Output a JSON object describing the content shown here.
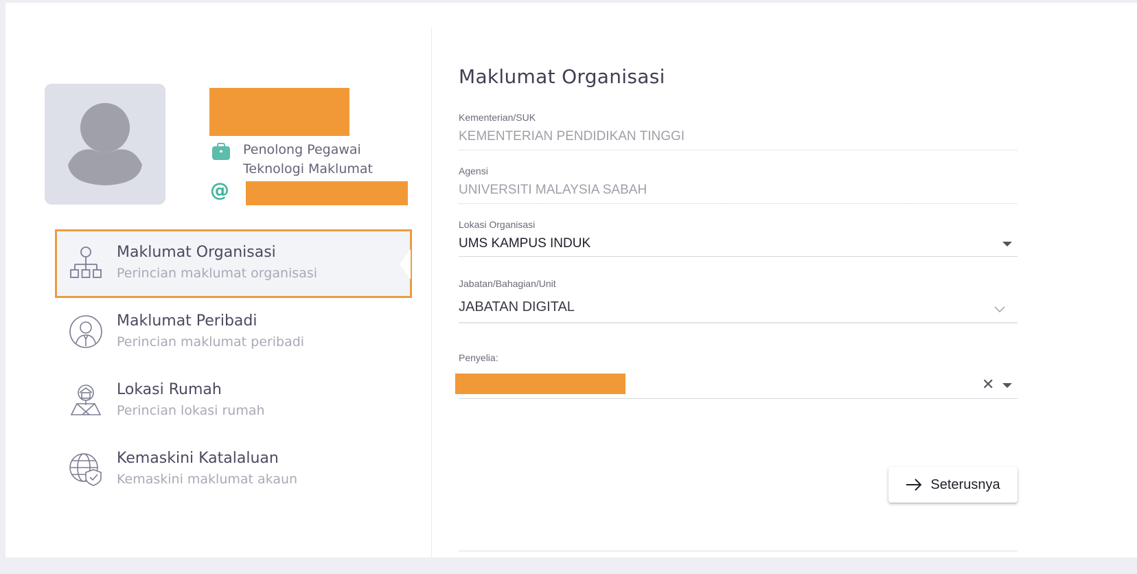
{
  "profile": {
    "job_title": "Penolong Pegawai Teknologi Maklumat",
    "icons": {
      "job": "briefcase-icon",
      "email": "at-icon"
    },
    "redaction_color": "#f29937"
  },
  "menu": {
    "items": [
      {
        "title": "Maklumat Organisasi",
        "subtitle": "Perincian maklumat organisasi",
        "icon": "org-chart-icon",
        "active": true
      },
      {
        "title": "Maklumat Peribadi",
        "subtitle": "Perincian maklumat peribadi",
        "icon": "person-icon",
        "active": false
      },
      {
        "title": "Lokasi Rumah",
        "subtitle": "Perincian lokasi rumah",
        "icon": "house-icon",
        "active": false
      },
      {
        "title": "Kemaskini Katalaluan",
        "subtitle": "Kemaskini maklumat akaun",
        "icon": "globe-shield-icon",
        "active": false
      }
    ],
    "active_border_color": "#ea9c44"
  },
  "form": {
    "title": "Maklumat Organisasi",
    "fields": {
      "kementerian": {
        "label": "Kementerian/SUK",
        "value": "KEMENTERIAN PENDIDIKAN TINGGI"
      },
      "agensi": {
        "label": "Agensi",
        "value": "UNIVERSITI MALAYSIA SABAH"
      },
      "lokasi": {
        "label": "Lokasi Organisasi",
        "value": "UMS KAMPUS INDUK"
      },
      "jabatan": {
        "label": "Jabatan/Bahagian/Unit",
        "value": "JABATAN DIGITAL"
      },
      "penyelia": {
        "label": "Penyelia:",
        "clear_glyph": "✕"
      }
    },
    "next_button": "Seterusnya"
  }
}
